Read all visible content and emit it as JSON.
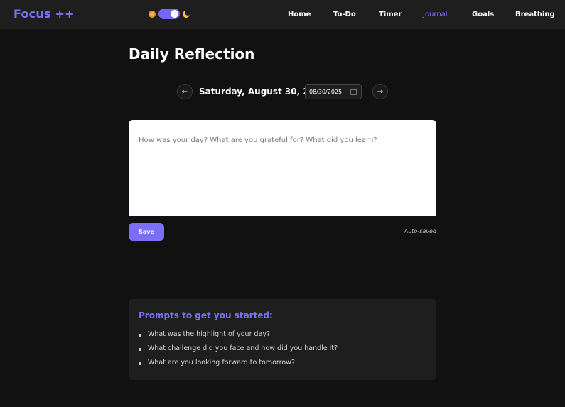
{
  "app": {
    "logo": "Focus ++"
  },
  "theme_toggle": {
    "mode": "dark",
    "sun_icon": "sun-icon",
    "moon_icon": "moon-icon",
    "accent": "#7468f0"
  },
  "nav": {
    "items": [
      {
        "label": "Home",
        "active": false
      },
      {
        "label": "To-Do",
        "active": false
      },
      {
        "label": "Timer",
        "active": false
      },
      {
        "label": "Journal",
        "active": true
      },
      {
        "label": "Goals",
        "active": false
      },
      {
        "label": "Breathing",
        "active": false
      }
    ]
  },
  "page": {
    "title": "Daily Reflection"
  },
  "date_nav": {
    "prev_label": "←",
    "next_label": "→",
    "date_text": "Saturday, August 30, 2025",
    "date_input_value": "08/30/2025"
  },
  "journal": {
    "placeholder": "How was your day? What are you grateful for? What did you learn?",
    "value": "",
    "save_label": "Save",
    "autosave_label": "Auto-saved"
  },
  "prompts": {
    "title": "Prompts to get you started:",
    "items": [
      "What was the highlight of your day?",
      "What challenge did you face and how did you handle it?",
      "What are you looking forward to tomorrow?"
    ]
  },
  "colors": {
    "background": "#111111",
    "navbar": "#1e1e1e",
    "accent": "#7b73f5",
    "button": "#7b6ff7"
  }
}
